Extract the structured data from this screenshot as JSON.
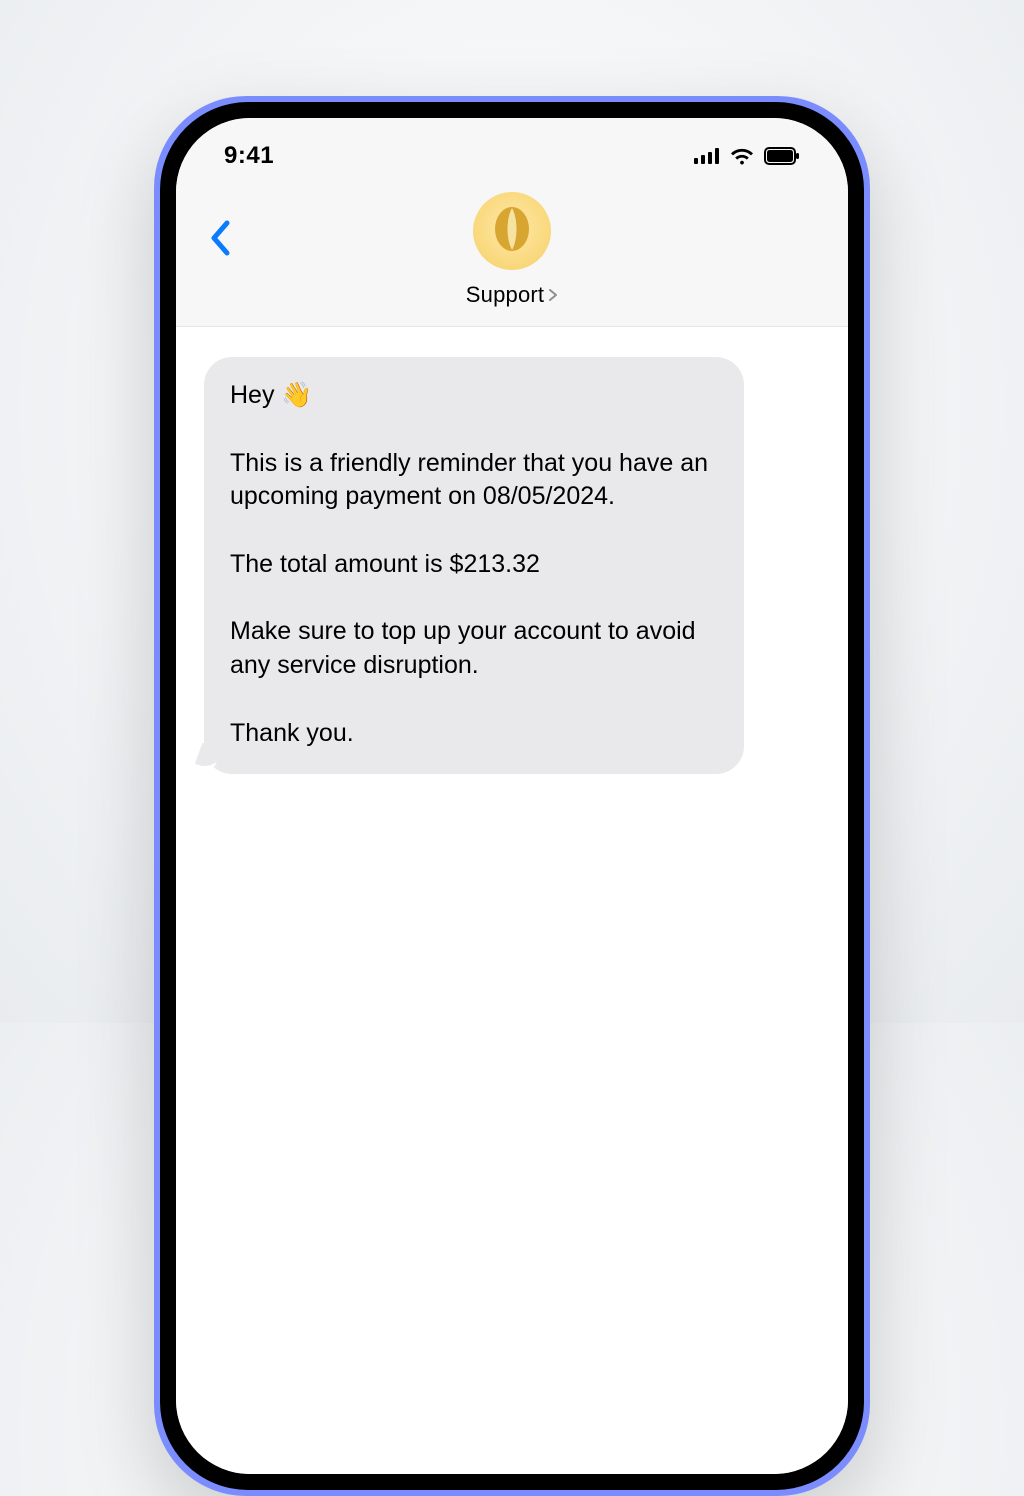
{
  "status": {
    "time": "9:41"
  },
  "header": {
    "contact_name": "Support"
  },
  "message": {
    "text": "Hey 👋\n\nThis is a friendly reminder that you have an upcoming payment on 08/05/2024.\n\nThe total amount is $213.32\n\nMake sure to top up your account to avoid any service disruption.\n\nThank you."
  }
}
